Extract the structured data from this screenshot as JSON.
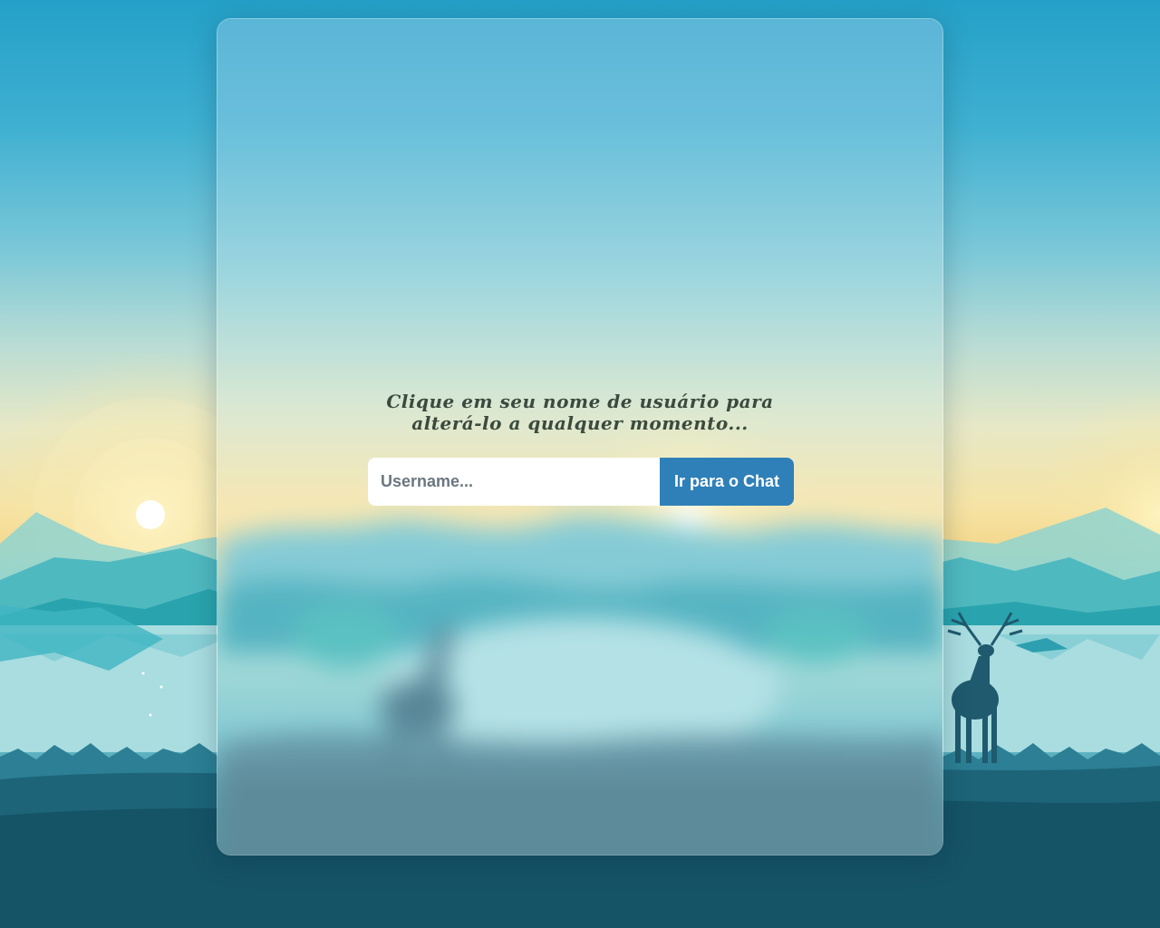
{
  "login": {
    "hint_line1": "Clique em seu nome de usuário para",
    "hint_line2": "alterá-lo a qualquer momento...",
    "username_placeholder": "Username...",
    "username_value": "",
    "submit_label": "Ir para o Chat"
  },
  "colors": {
    "button_bg": "#2f80b8",
    "button_text": "#ffffff",
    "hint_text": "#3b4a3e",
    "input_bg": "#ffffff"
  }
}
